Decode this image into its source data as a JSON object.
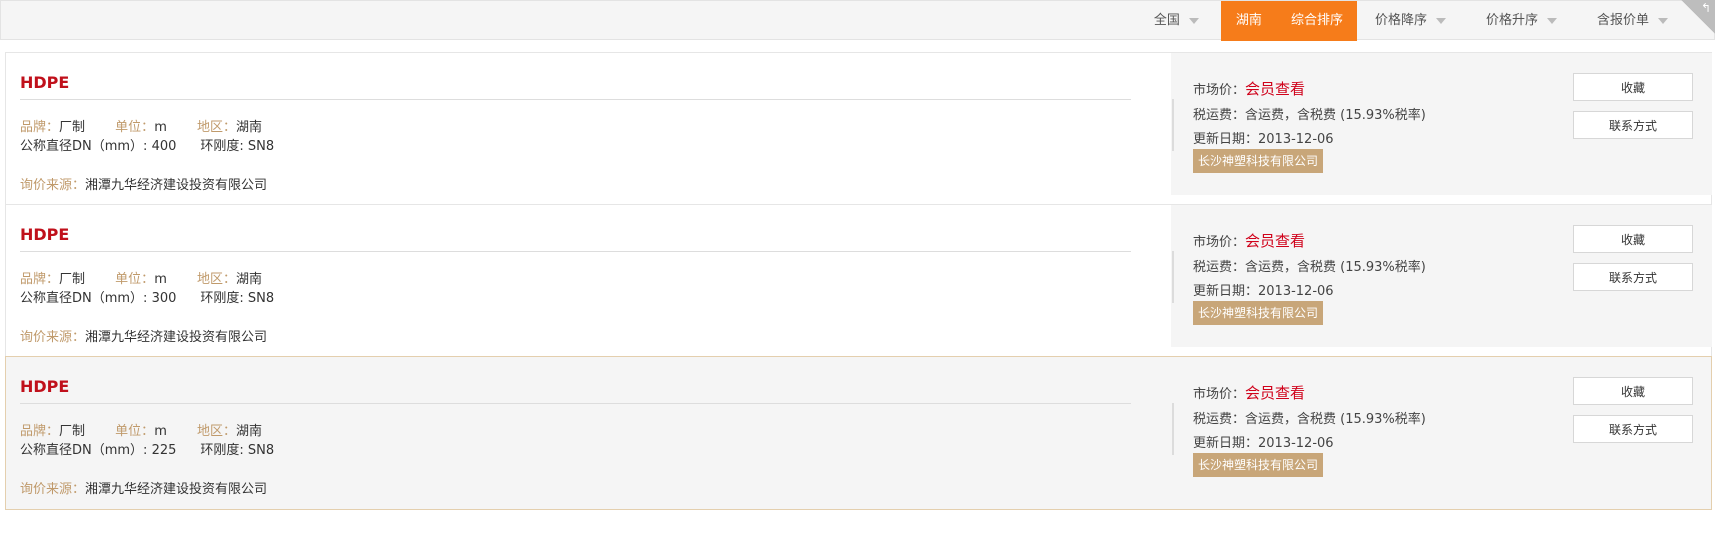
{
  "filters": {
    "region": "全国",
    "province": "湖南",
    "sort_default": "综合排序",
    "price_desc": "价格降序",
    "price_asc": "价格升序",
    "with_quote": "含报价单",
    "corner_icon": "back-arrow"
  },
  "labels": {
    "brand": "品牌：",
    "unit": "单位：",
    "area": "地区：",
    "source": "询价来源：",
    "market_price": "市场价：",
    "tax_shipping": "税运费：",
    "update_date": "更新日期：",
    "favorite_btn": "收藏",
    "contact_btn": "联系方式"
  },
  "items": [
    {
      "name": "HDPE",
      "brand": "厂制",
      "unit": "m",
      "area": "湖南",
      "spec": "公称直径DN（mm）: 400",
      "stiffness": "环刚度: SN8",
      "source": "湘潭九华经济建设投资有限公司",
      "price": "会员查看",
      "tax": "含运费，含税费 (15.93%税率)",
      "date": "2013-12-06",
      "company": "长沙神塑科技有限公司"
    },
    {
      "name": "HDPE",
      "brand": "厂制",
      "unit": "m",
      "area": "湖南",
      "spec": "公称直径DN（mm）: 300",
      "stiffness": "环刚度: SN8",
      "source": "湘潭九华经济建设投资有限公司",
      "price": "会员查看",
      "tax": "含运费，含税费 (15.93%税率)",
      "date": "2013-12-06",
      "company": "长沙神塑科技有限公司"
    },
    {
      "name": "HDPE",
      "brand": "厂制",
      "unit": "m",
      "area": "湖南",
      "spec": "公称直径DN（mm）: 225",
      "stiffness": "环刚度: SN8",
      "source": "湘潭九华经济建设投资有限公司",
      "price": "会员查看",
      "tax": "含运费，含税费 (15.93%税率)",
      "date": "2013-12-06",
      "company": "长沙神塑科技有限公司"
    }
  ],
  "colors": {
    "accent_orange": "#f67c1a",
    "title_red": "#c0101b",
    "label_tan": "#c09a6b",
    "badge_tan": "#c8a679"
  }
}
